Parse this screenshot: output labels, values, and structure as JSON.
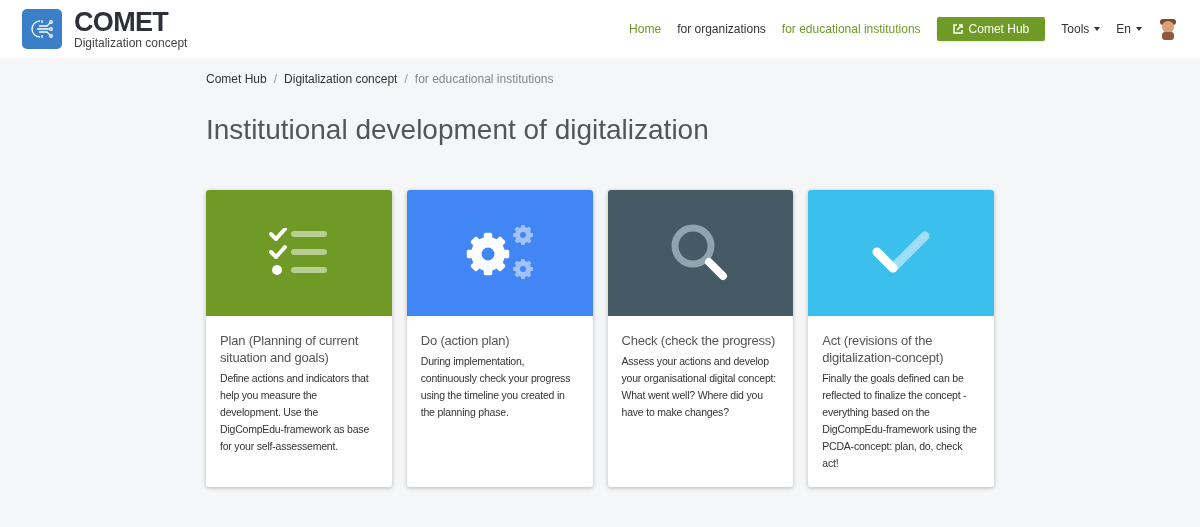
{
  "logo": {
    "title": "COMET",
    "subtitle": "Digitalization concept"
  },
  "nav": [
    {
      "label": "Home",
      "selected": true
    },
    {
      "label": "for organizations",
      "selected": false
    },
    {
      "label": "for educational institutions",
      "selected": true
    }
  ],
  "hub_button": "Comet Hub",
  "menus": [
    "Tools",
    "En"
  ],
  "breadcrumb_separator": "/",
  "breadcrumb": [
    {
      "label": "Comet Hub",
      "current": false
    },
    {
      "label": "Digitalization concept",
      "current": false
    },
    {
      "label": "for educational institutions",
      "current": true
    }
  ],
  "heading": "Institutional development of digitalization",
  "cards": [
    {
      "kind": "checklist",
      "color": "#6e9a25",
      "title": "Plan (Planning of current situation and goals)",
      "text": "Define actions and indicators that help you measure the development. Use the DigCompEdu-framework as base for your self-assessement."
    },
    {
      "kind": "gears",
      "color": "#4285f4",
      "title": "Do (action plan)",
      "text": "During implementation, continuously check your progress using the timeline you created in the planning phase."
    },
    {
      "kind": "magnifier",
      "color": "#455a64",
      "title": "Check (check the progress)",
      "text": "Assess your actions and develop your organisational digital concept: What went well? Where did you have to make changes?"
    },
    {
      "kind": "checkmark",
      "color": "#3bbfec",
      "title": "Act (revisions of the digitalization-concept)",
      "text": "Finally the goals defined can be reflected to finalize the concept - everything based on the DigCompEdu-framework using the PCDA-concept: plan, do, check act!"
    }
  ]
}
